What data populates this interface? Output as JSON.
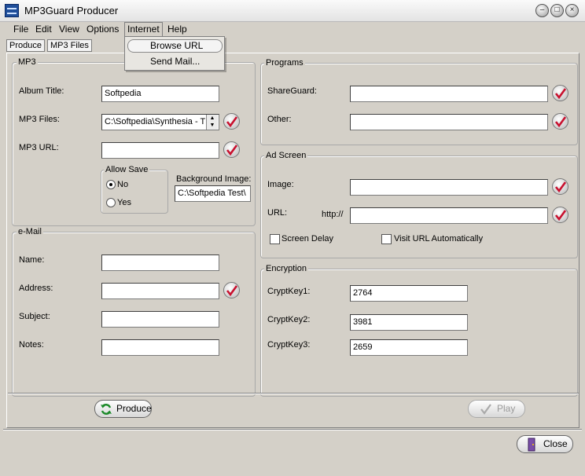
{
  "window": {
    "title": "MP3Guard Producer"
  },
  "menu": {
    "file": "File",
    "edit": "Edit",
    "view": "View",
    "options": "Options",
    "internet": "Internet",
    "help": "Help",
    "dropdown": [
      "Browse URL",
      "Send Mail..."
    ]
  },
  "tabs": [
    "Produce",
    "MP3 Files"
  ],
  "mp3": {
    "title": "MP3",
    "album_title_label": "Album Title:",
    "album_title_value": "Softpedia",
    "mp3_files_label": "MP3 Files:",
    "mp3_files_value": "C:\\Softpedia\\Synthesia - T",
    "mp3_url_label": "MP3 URL:",
    "mp3_url_value": "",
    "allow_save_title": "Allow Save",
    "no_label": "No",
    "yes_label": "Yes",
    "allow_save_selected": "No",
    "background_image_label": "Background Image:",
    "background_image_value": "C:\\Softpedia Test\\"
  },
  "email": {
    "title": "e-Mail",
    "name_label": "Name:",
    "name_value": "",
    "address_label": "Address:",
    "address_value": "",
    "subject_label": "Subject:",
    "subject_value": "",
    "notes_label": "Notes:",
    "notes_value": ""
  },
  "programs": {
    "title": "Programs",
    "shareguard_label": "ShareGuard:",
    "shareguard_value": "",
    "other_label": "Other:",
    "other_value": ""
  },
  "ad_screen": {
    "title": "Ad Screen",
    "image_label": "Image:",
    "image_value": "",
    "url_label": "URL:",
    "url_prefix": "http://",
    "url_value": "",
    "screen_delay_label": "Screen Delay",
    "visit_url_label": "Visit URL Automatically",
    "screen_delay_checked": false,
    "visit_url_checked": false
  },
  "encryption": {
    "title": "Encryption",
    "key1_label": "CryptKey1:",
    "key1_value": "2764",
    "key2_label": "CryptKey2:",
    "key2_value": "3981",
    "key3_label": "CryptKey3:",
    "key3_value": "2659"
  },
  "buttons": {
    "produce": "Produce",
    "play": "Play",
    "close": "Close"
  },
  "icons": {
    "check": "red-checkmark-icon",
    "produce": "green-refresh-icon",
    "close": "door-exit-icon"
  },
  "colors": {
    "check_red": "#c8102e",
    "produce_green": "#1d8a2a"
  }
}
